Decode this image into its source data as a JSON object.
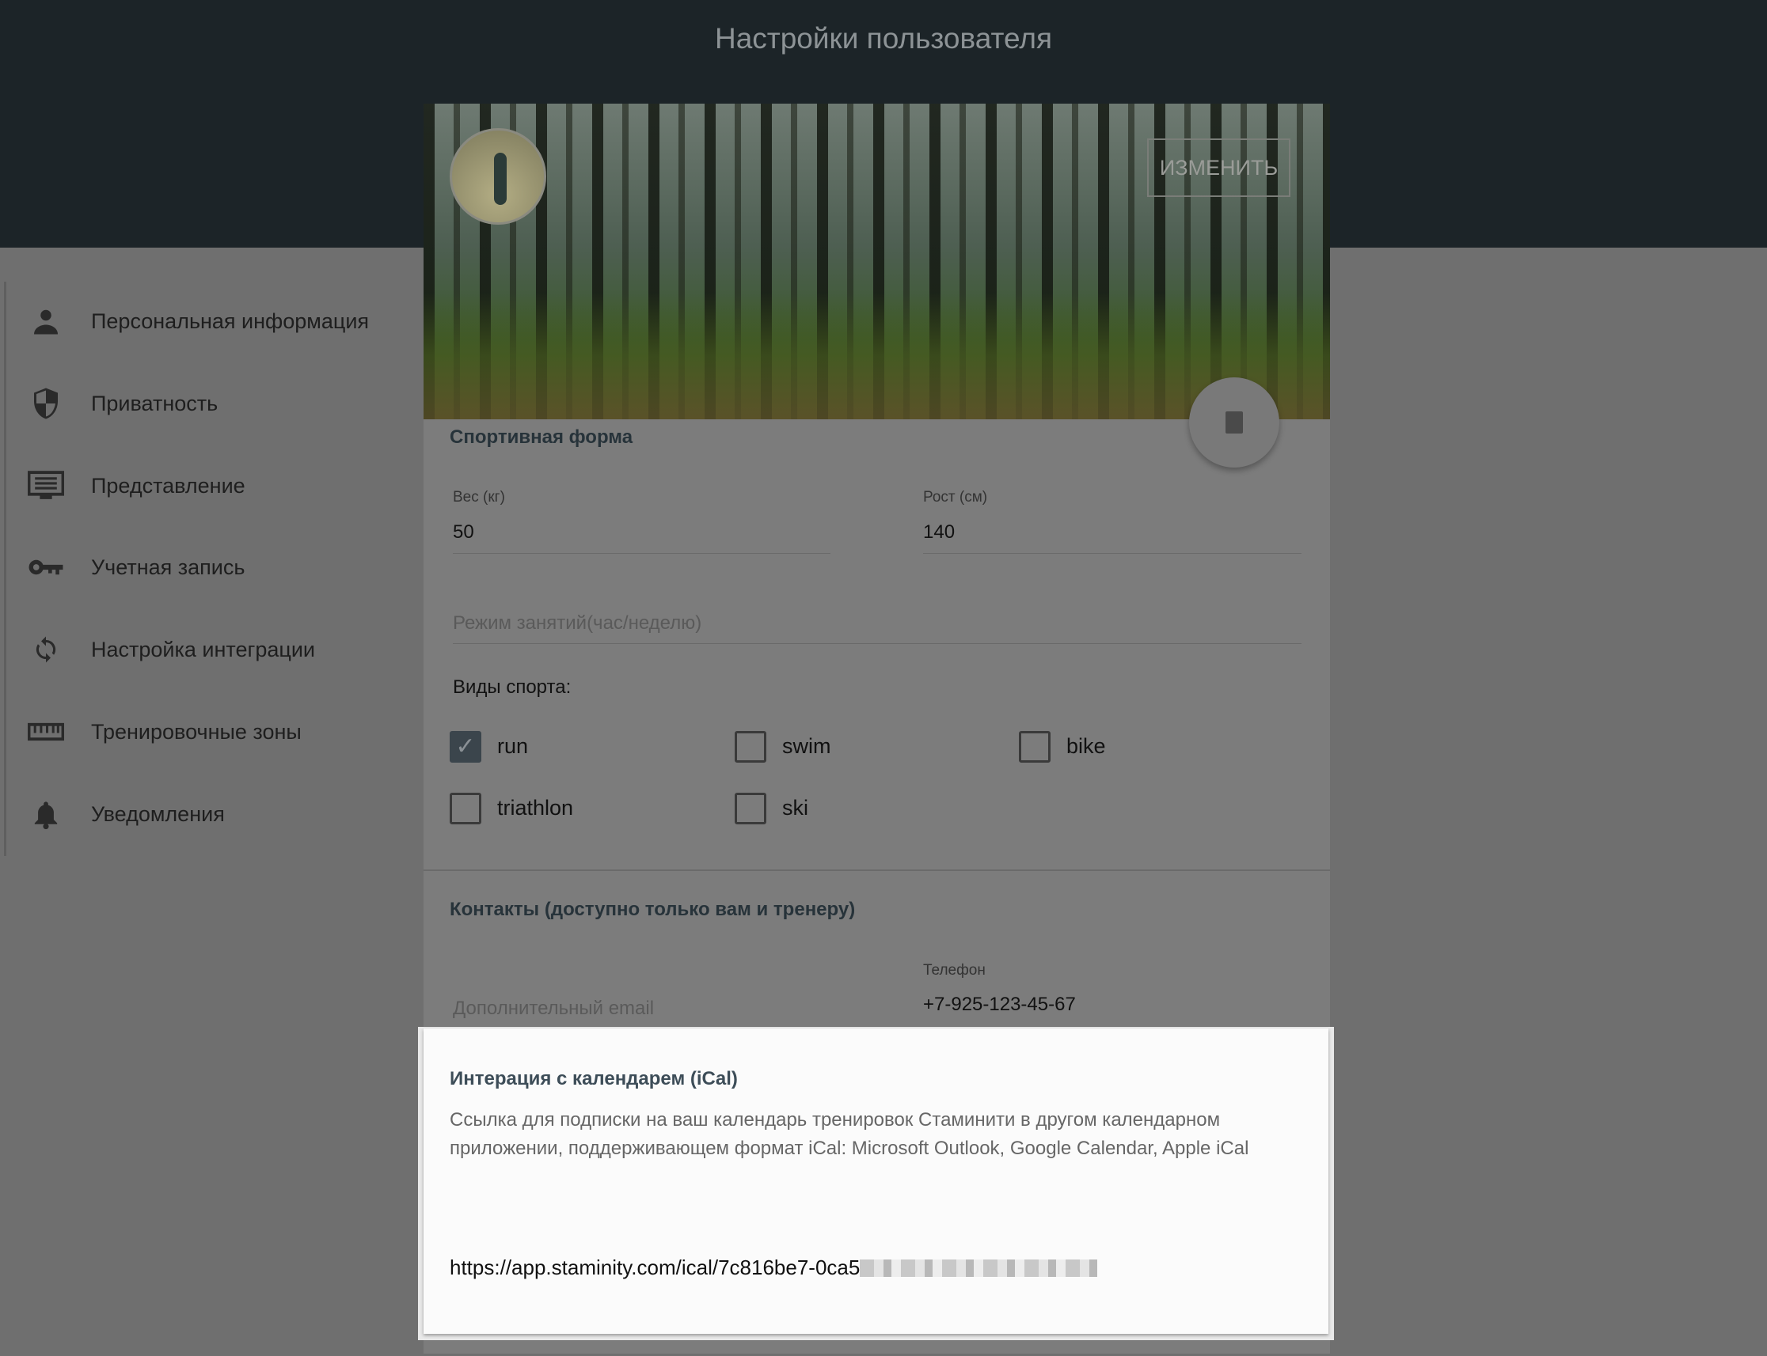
{
  "header": {
    "title": "Настройки пользователя"
  },
  "sidebar": {
    "items": [
      {
        "label": "Персональная информация",
        "icon": "person-icon"
      },
      {
        "label": "Приватность",
        "icon": "shield-icon"
      },
      {
        "label": "Представление",
        "icon": "display-icon"
      },
      {
        "label": "Учетная запись",
        "icon": "key-icon"
      },
      {
        "label": "Настройка интеграции",
        "icon": "sync-icon"
      },
      {
        "label": "Тренировочные зоны",
        "icon": "ruler-icon"
      },
      {
        "label": "Уведомления",
        "icon": "bell-icon"
      }
    ]
  },
  "banner": {
    "edit_label": "ИЗМЕНИТЬ"
  },
  "sport": {
    "title": "Спортивная форма",
    "weight_label": "Вес (кг)",
    "weight_value": "50",
    "height_label": "Рост (см)",
    "height_value": "140",
    "activity_placeholder": "Режим занятий(час/неделю)",
    "sports_label": "Виды спорта:",
    "sports": [
      {
        "label": "run",
        "checked": true
      },
      {
        "label": "swim",
        "checked": false
      },
      {
        "label": "bike",
        "checked": false
      },
      {
        "label": "triathlon",
        "checked": false
      },
      {
        "label": "ski",
        "checked": false
      }
    ]
  },
  "contacts": {
    "title": "Контакты (доступно только вам и тренеру)",
    "email_placeholder": "Дополнительный email",
    "phone_label": "Телефон",
    "phone_value": "+7-925-123-45-67"
  },
  "ical": {
    "title": "Интерация с календарем (iCal)",
    "description": "Ссылка для подписки на ваш календарь тренировок Стаминити в другом календарном приложении, поддерживающем формат iCal: Microsoft Outlook, Google Calendar, Apple iCal",
    "url_visible": "https://app.staminity.com/ical/7c816be7-0ca5"
  },
  "colors": {
    "header": "#1c2428",
    "checkbox_checked": "#3b454c",
    "section_title": "#3d4d58"
  }
}
